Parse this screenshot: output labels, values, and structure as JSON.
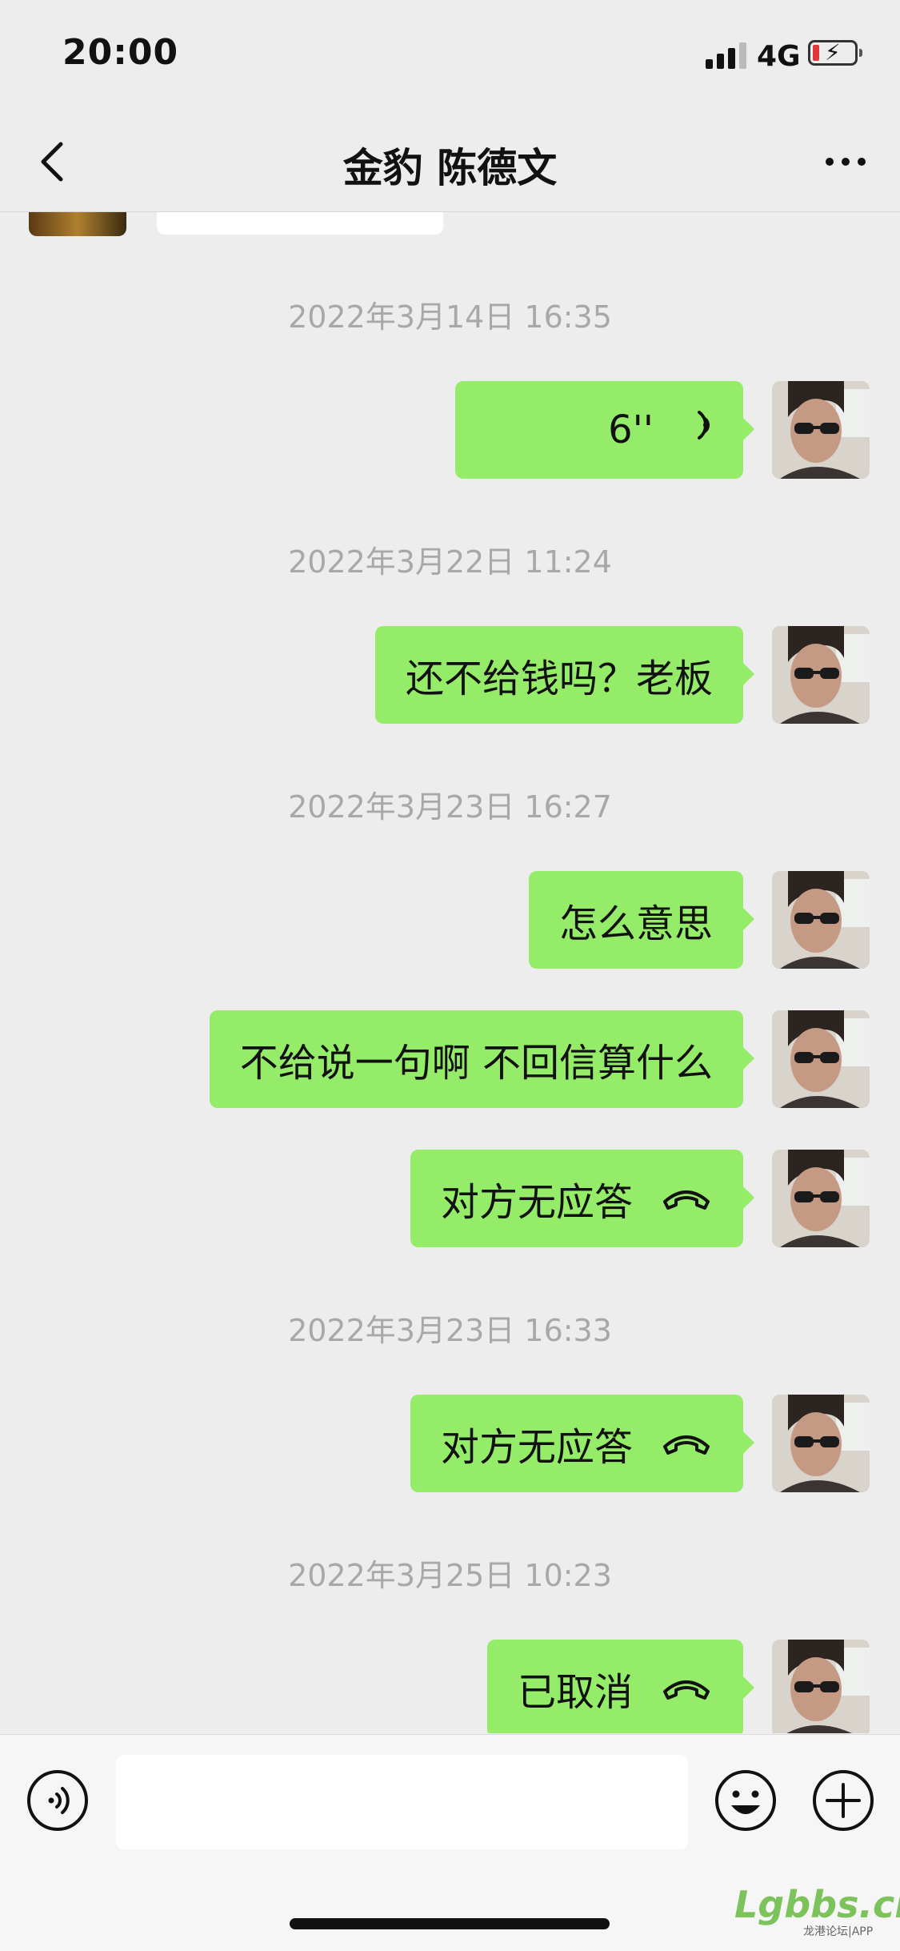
{
  "status_bar": {
    "time": "20:00",
    "network": "4G"
  },
  "nav": {
    "title": "金豹 陈德文"
  },
  "messages": [
    {
      "timestamp": "2022年3月14日 16:35",
      "text": "6''",
      "icon": "voice-waves-icon"
    },
    {
      "timestamp": "2022年3月22日 11:24",
      "text": "还不给钱吗？老板"
    },
    {
      "timestamp": "2022年3月23日 16:27",
      "text": "怎么意思"
    },
    {
      "text": "不给说一句啊  不回信算什么"
    },
    {
      "text": "对方无应答",
      "icon": "phone-hangup-icon"
    },
    {
      "timestamp": "2022年3月23日 16:33",
      "text": "对方无应答",
      "icon": "phone-hangup-icon"
    },
    {
      "timestamp": "2022年3月25日 10:23",
      "text": "已取消",
      "icon": "phone-hangup-icon"
    }
  ],
  "input": {
    "placeholder": ""
  },
  "watermark": {
    "logo": "Lgbbs.cn",
    "sub": "龙港论坛|APP"
  },
  "colors": {
    "bubble_self": "#95ec69",
    "background": "#ededed",
    "timestamp": "#a8a8a8"
  }
}
